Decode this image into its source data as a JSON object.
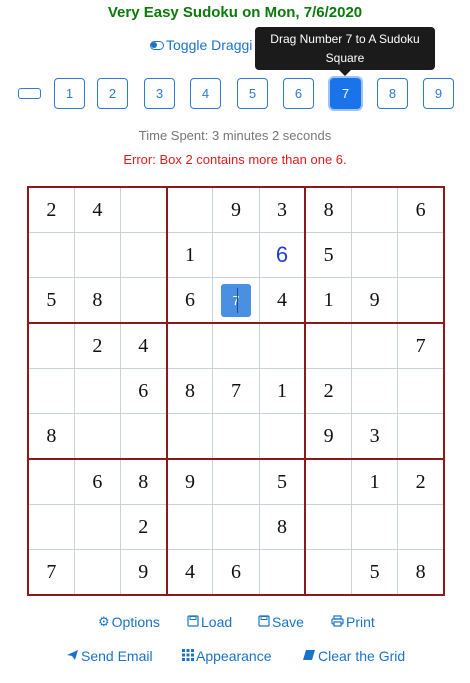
{
  "title": "Very Easy Sudoku on Mon, 7/6/2020",
  "toggle_label": "Toggle Draggi",
  "tooltip": {
    "line1": "Drag Number 7 to A Sudoku",
    "line2": "Square"
  },
  "number_buttons": [
    "",
    "1",
    "2",
    "3",
    "4",
    "5",
    "6",
    "7",
    "8",
    "9"
  ],
  "active_number": "7",
  "time_spent": "Time Spent: 3 minutes 2 seconds",
  "error": "Error: Box 2 contains more than one 6.",
  "grid": [
    [
      "2",
      "4",
      "",
      "",
      "9",
      "3",
      "8",
      "",
      "6"
    ],
    [
      "",
      "",
      "",
      "1",
      "",
      "6",
      "5",
      "",
      ""
    ],
    [
      "5",
      "8",
      "",
      "6",
      "7",
      "4",
      "1",
      "9",
      ""
    ],
    [
      "",
      "2",
      "4",
      "",
      "",
      "",
      "",
      "",
      "7"
    ],
    [
      "",
      "",
      "6",
      "8",
      "7",
      "1",
      "2",
      "",
      ""
    ],
    [
      "8",
      "",
      "",
      "",
      "",
      "",
      "9",
      "3",
      ""
    ],
    [
      "",
      "6",
      "8",
      "9",
      "",
      "5",
      "",
      "1",
      "2"
    ],
    [
      "",
      "",
      "2",
      "",
      "",
      "8",
      "",
      "",
      ""
    ],
    [
      "7",
      "",
      "9",
      "4",
      "6",
      "",
      "",
      "5",
      "8"
    ]
  ],
  "links_row1": [
    "Options",
    "Load",
    "Save",
    "Print"
  ],
  "links_row2": [
    "Send Email",
    "Appearance",
    "Clear the Grid"
  ],
  "colors": {
    "title": "#0a7a0a",
    "accent": "#1a73e8",
    "error": "#e01b1b",
    "box_border": "#8b1a1a",
    "user_entry": "#1f3fd0"
  },
  "icons": {
    "toggle": "toggle-icon",
    "options": "gear-icon",
    "load": "save-icon",
    "save": "save-icon",
    "print": "print-icon",
    "email": "send-icon",
    "appearance": "grid-icon",
    "clear": "eraser-icon"
  }
}
